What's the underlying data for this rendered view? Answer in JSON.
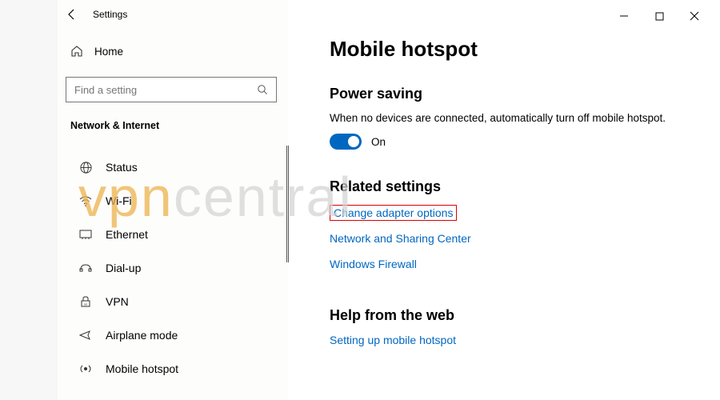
{
  "titlebar": {
    "title": "Settings"
  },
  "sidebar": {
    "home": "Home",
    "search_placeholder": "Find a setting",
    "category": "Network & Internet",
    "items": [
      {
        "label": "Status"
      },
      {
        "label": "Wi-Fi"
      },
      {
        "label": "Ethernet"
      },
      {
        "label": "Dial-up"
      },
      {
        "label": "VPN"
      },
      {
        "label": "Airplane mode"
      },
      {
        "label": "Mobile hotspot"
      }
    ]
  },
  "main": {
    "heading": "Mobile hotspot",
    "power_saving": {
      "title": "Power saving",
      "desc": "When no devices are connected, automatically turn off mobile hotspot.",
      "toggle_state": "On"
    },
    "related": {
      "title": "Related settings",
      "links": [
        "Change adapter options",
        "Network and Sharing Center",
        "Windows Firewall"
      ]
    },
    "help": {
      "title": "Help from the web",
      "link": "Setting up mobile hotspot"
    }
  },
  "watermark": {
    "left": "vpn",
    "right": "central"
  }
}
